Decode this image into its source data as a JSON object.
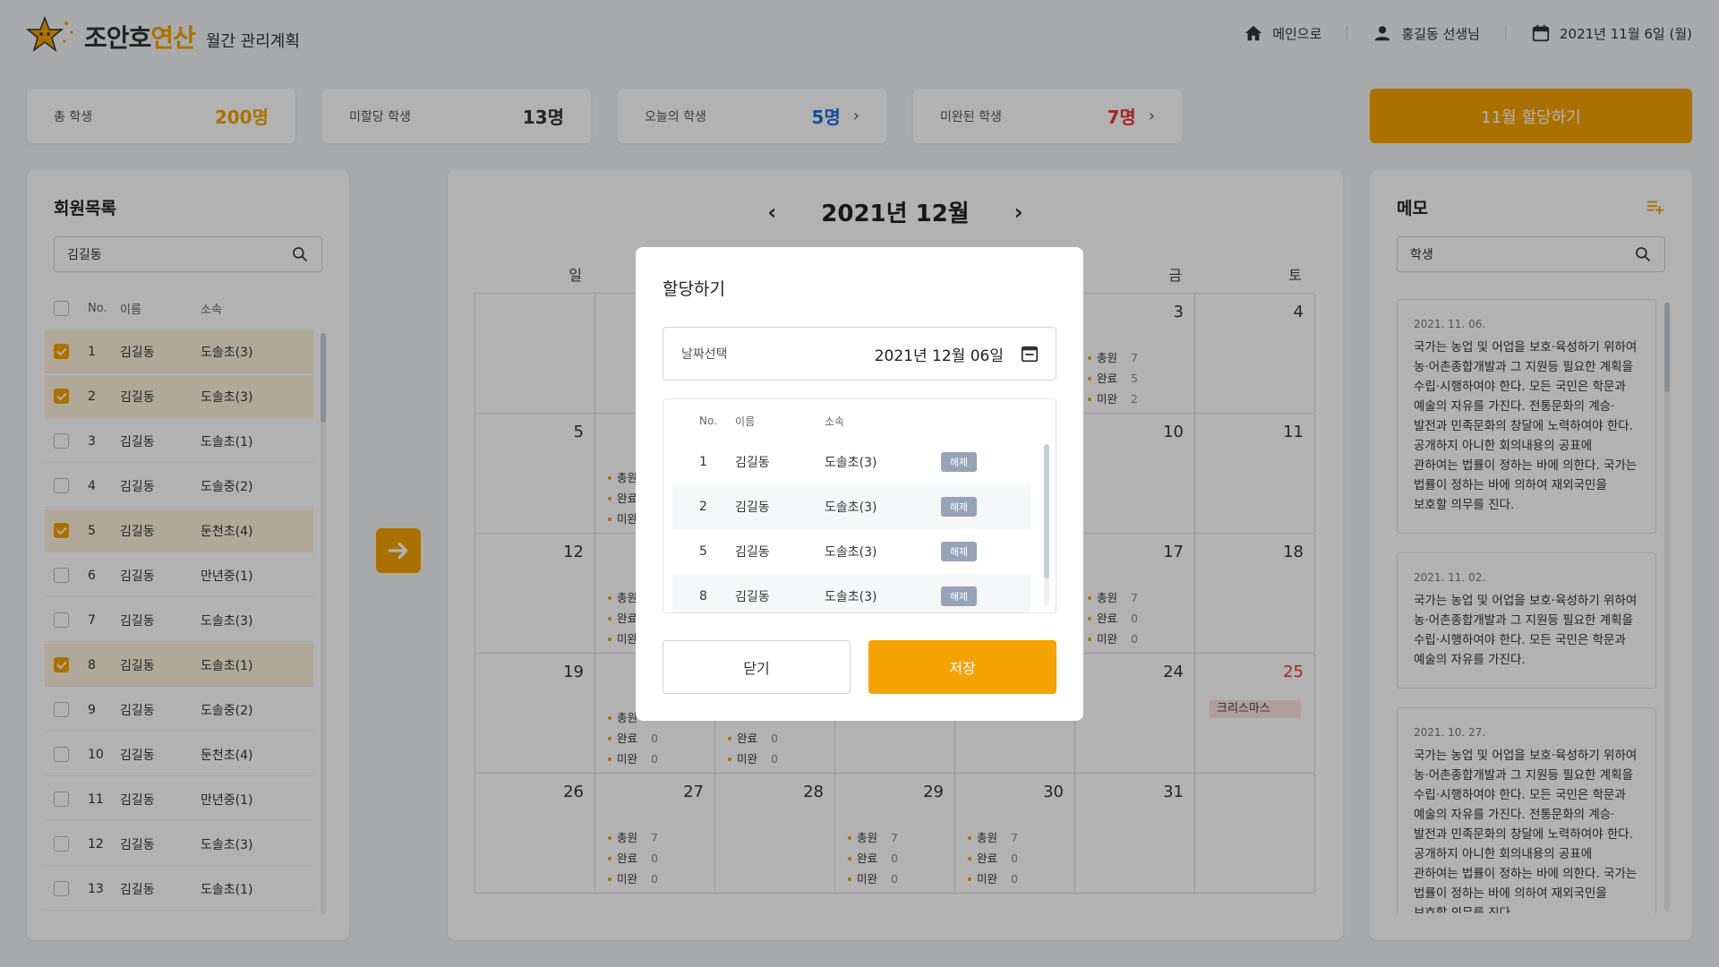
{
  "header": {
    "brand_a": "조안호",
    "brand_b": "연산",
    "subtitle": "월간 관리계획",
    "nav_home": "메인으로",
    "nav_user": "홍길동 선생님",
    "nav_date": "2021년 11월 6일 (월)"
  },
  "stats": [
    {
      "label": "총 학생",
      "value": "200명",
      "color": "#f5a300"
    },
    {
      "label": "미할당 학생",
      "value": "13명",
      "color": "#333333"
    },
    {
      "label": "오늘의 학생",
      "value": "5명",
      "color": "#1e6fd9"
    },
    {
      "label": "미완된 학생",
      "value": "7명",
      "color": "#e53935"
    }
  ],
  "assign_button": "11월 할당하기",
  "members": {
    "title": "회원목록",
    "search_value": "김길동",
    "headers": {
      "no": "No.",
      "name": "이름",
      "org": "소속"
    },
    "rows": [
      {
        "no": "1",
        "name": "김길동",
        "org": "도솔초(3)",
        "checked": true
      },
      {
        "no": "2",
        "name": "김길동",
        "org": "도솔초(3)",
        "checked": true
      },
      {
        "no": "3",
        "name": "김길동",
        "org": "도솔초(1)",
        "checked": false
      },
      {
        "no": "4",
        "name": "김길동",
        "org": "도솔중(2)",
        "checked": false
      },
      {
        "no": "5",
        "name": "김길동",
        "org": "둔천초(4)",
        "checked": true
      },
      {
        "no": "6",
        "name": "김길동",
        "org": "만년중(1)",
        "checked": false
      },
      {
        "no": "7",
        "name": "김길동",
        "org": "도솔초(3)",
        "checked": false
      },
      {
        "no": "8",
        "name": "김길동",
        "org": "도솔초(1)",
        "checked": true
      },
      {
        "no": "9",
        "name": "김길동",
        "org": "도솔중(2)",
        "checked": false
      },
      {
        "no": "10",
        "name": "김길동",
        "org": "둔천초(4)",
        "checked": false
      },
      {
        "no": "11",
        "name": "김길동",
        "org": "만년중(1)",
        "checked": false
      },
      {
        "no": "12",
        "name": "김길동",
        "org": "도솔초(3)",
        "checked": false
      },
      {
        "no": "13",
        "name": "김길동",
        "org": "도솔초(1)",
        "checked": false
      }
    ]
  },
  "calendar": {
    "title": "2021년 12월",
    "dow": [
      "일",
      "",
      "",
      "",
      "",
      "금",
      "토"
    ],
    "stat_labels": {
      "total": "총원",
      "done": "완료",
      "undone": "미완"
    },
    "cells": [
      {
        "row": 0,
        "col": 5,
        "day": "3",
        "stats": [
          "7",
          "5",
          "2"
        ]
      },
      {
        "row": 0,
        "col": 6,
        "day": "4"
      },
      {
        "row": 1,
        "col": 0,
        "day": "5"
      },
      {
        "row": 1,
        "col": 1,
        "day": "",
        "stats": [
          "",
          "",
          ""
        ]
      },
      {
        "row": 1,
        "col": 5,
        "day": "10"
      },
      {
        "row": 1,
        "col": 6,
        "day": "11"
      },
      {
        "row": 2,
        "col": 0,
        "day": "12"
      },
      {
        "row": 2,
        "col": 1,
        "day": "",
        "stats": [
          "",
          "",
          ""
        ]
      },
      {
        "row": 2,
        "col": 5,
        "day": "17",
        "stats": [
          "7",
          "0",
          "0"
        ]
      },
      {
        "row": 2,
        "col": 6,
        "day": "18"
      },
      {
        "row": 3,
        "col": 0,
        "day": "19"
      },
      {
        "row": 3,
        "col": 1,
        "day": "",
        "stats": [
          "",
          "0",
          "0"
        ]
      },
      {
        "row": 3,
        "col": 2,
        "day": "",
        "stats": [
          "",
          "0",
          "0"
        ],
        "partial": true
      },
      {
        "row": 3,
        "col": 5,
        "day": "24"
      },
      {
        "row": 3,
        "col": 6,
        "day": "25",
        "red": true,
        "holiday": "크리스마스"
      },
      {
        "row": 4,
        "col": 0,
        "day": "26"
      },
      {
        "row": 4,
        "col": 1,
        "day": "27",
        "stats": [
          "7",
          "0",
          "0"
        ]
      },
      {
        "row": 4,
        "col": 2,
        "day": "28"
      },
      {
        "row": 4,
        "col": 3,
        "day": "29",
        "stats": [
          "7",
          "0",
          "0"
        ]
      },
      {
        "row": 4,
        "col": 4,
        "day": "30",
        "stats": [
          "7",
          "0",
          "0"
        ]
      },
      {
        "row": 4,
        "col": 5,
        "day": "31"
      },
      {
        "row": 4,
        "col": 6,
        "day": ""
      }
    ]
  },
  "memo": {
    "title": "메모",
    "search_value": "학생",
    "items": [
      {
        "date": "2021. 11. 06.",
        "text": "국가는 농업 및 어업을 보호·육성하기 위하여 농·어촌종합개발과 그 지원등 필요한 계획을 수립·시행하여야 한다. 모든 국민은 학문과 예술의 자유를 가진다. 전통문화의 계승·발전과 민족문화의 창달에 노력하여야 한다. 공개하지 아니한 회의내용의 공표에 관하여는 법률이 정하는 바에 의한다. 국가는 법률이 정하는 바에 의하여 재외국민을 보호할 의무를 진다."
      },
      {
        "date": "2021. 11. 02.",
        "text": "국가는 농업 및 어업을 보호·육성하기 위하여 농·어촌종합개발과 그 지원등 필요한 계획을 수립·시행하여야 한다. 모든 국민은 학문과 예술의 자유를 가진다."
      },
      {
        "date": "2021. 10. 27.",
        "text": "국가는 농업 및 어업을 보호·육성하기 위하여 농·어촌종합개발과 그 지원등 필요한 계획을 수립·시행하여야 한다. 모든 국민은 학문과 예술의 자유를 가진다. 전통문화의 계승·발전과 민족문화의 창달에 노력하여야 한다. 공개하지 아니한 회의내용의 공표에 관하여는 법률이 정하는 바에 의한다. 국가는 법률이 정하는 바에 의하여 재외국민을 보호할 의무를 진다."
      }
    ]
  },
  "modal": {
    "title": "할당하기",
    "date_label": "날짜선택",
    "date_value": "2021년 12월 06일",
    "headers": {
      "no": "No.",
      "name": "이름",
      "org": "소속"
    },
    "rows": [
      {
        "no": "1",
        "name": "김길동",
        "org": "도솔초(3)",
        "action": "해제"
      },
      {
        "no": "2",
        "name": "김길동",
        "org": "도솔초(3)",
        "action": "해제"
      },
      {
        "no": "5",
        "name": "김길동",
        "org": "도솔초(3)",
        "action": "해제"
      },
      {
        "no": "8",
        "name": "김길동",
        "org": "도솔초(3)",
        "action": "해제"
      }
    ],
    "close_label": "닫기",
    "save_label": "저장"
  }
}
